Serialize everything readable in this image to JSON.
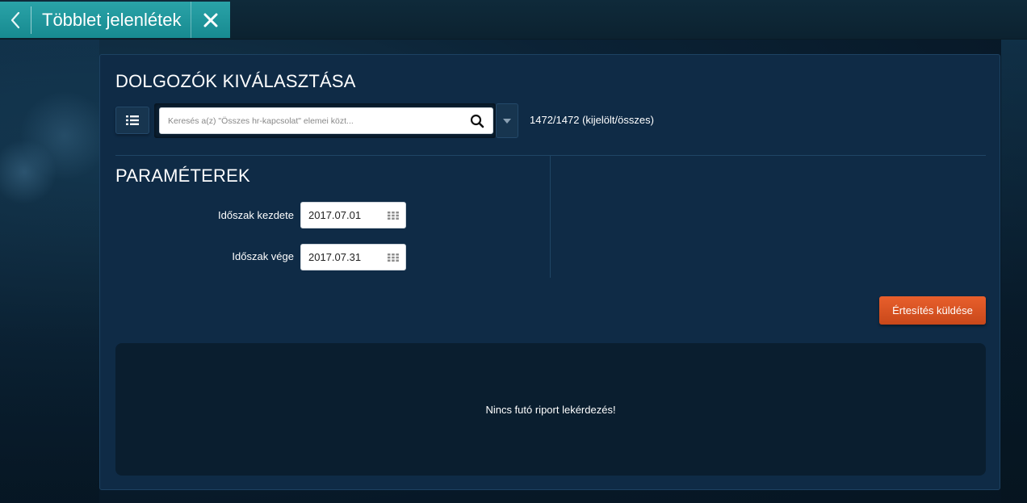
{
  "header": {
    "title": "Többlet jelenlétek"
  },
  "employees": {
    "section_title": "DOLGOZÓK KIVÁLASZTÁSA",
    "search_placeholder": "Keresés a(z) \"Összes hr-kapcsolat\" elemei közt...",
    "search_value": "",
    "count_text": "1472/1472 (kijelölt/összes)"
  },
  "parameters": {
    "section_title": "PARAMÉTEREK",
    "start_label": "Időszak kezdete",
    "start_value": "2017.07.01",
    "end_label": "Időszak vége",
    "end_value": "2017.07.31"
  },
  "actions": {
    "notify_label": "Értesítés küldése"
  },
  "report": {
    "message": "Nincs futó riport lekérdezés!"
  },
  "colors": {
    "tab_accent": "#1d959b",
    "panel_bg": "#0f2b46",
    "button_orange": "#dc5424"
  },
  "icons": {
    "back": "chevron-left-icon",
    "close": "close-icon",
    "list": "list-icon",
    "search": "search-icon",
    "dropdown": "caret-down-icon",
    "calendar": "calendar-grid-icon"
  }
}
